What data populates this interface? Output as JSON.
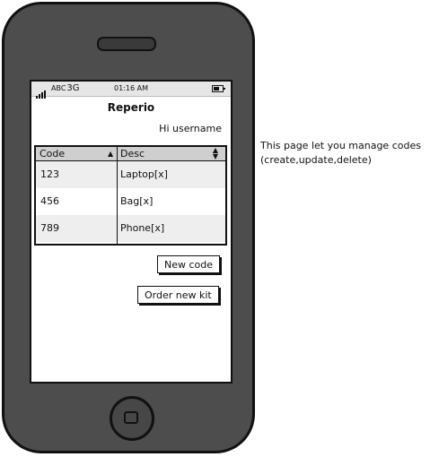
{
  "status_bar": {
    "carrier": "ABC",
    "network": "3G",
    "time": "01:16 AM"
  },
  "app": {
    "title": "Reperio",
    "greeting": "Hi username"
  },
  "table": {
    "columns": [
      {
        "label": "Code",
        "sort": "ascending"
      },
      {
        "label": "Desc",
        "sort": "sortable"
      }
    ],
    "rows": [
      {
        "code": "123",
        "desc": "Laptop[x]"
      },
      {
        "code": "456",
        "desc": "Bag[x]"
      },
      {
        "code": "789",
        "desc": "Phone[x]"
      }
    ]
  },
  "buttons": {
    "new_code": "New code",
    "order_kit": "Order new kit"
  },
  "annotation": {
    "line1": "This page let you manage codes",
    "line2": "(create,update,delete)"
  },
  "icons": {
    "signal": "signal-bars-icon",
    "battery": "battery-icon",
    "sort_asc": "triangle-up-icon",
    "sort_both": "sort-arrows-icon",
    "home": "home-button-icon"
  },
  "colors": {
    "phone_body": "#4d4d4d",
    "table_header": "#cfcfcf",
    "row_shade": "#eeeeee"
  }
}
